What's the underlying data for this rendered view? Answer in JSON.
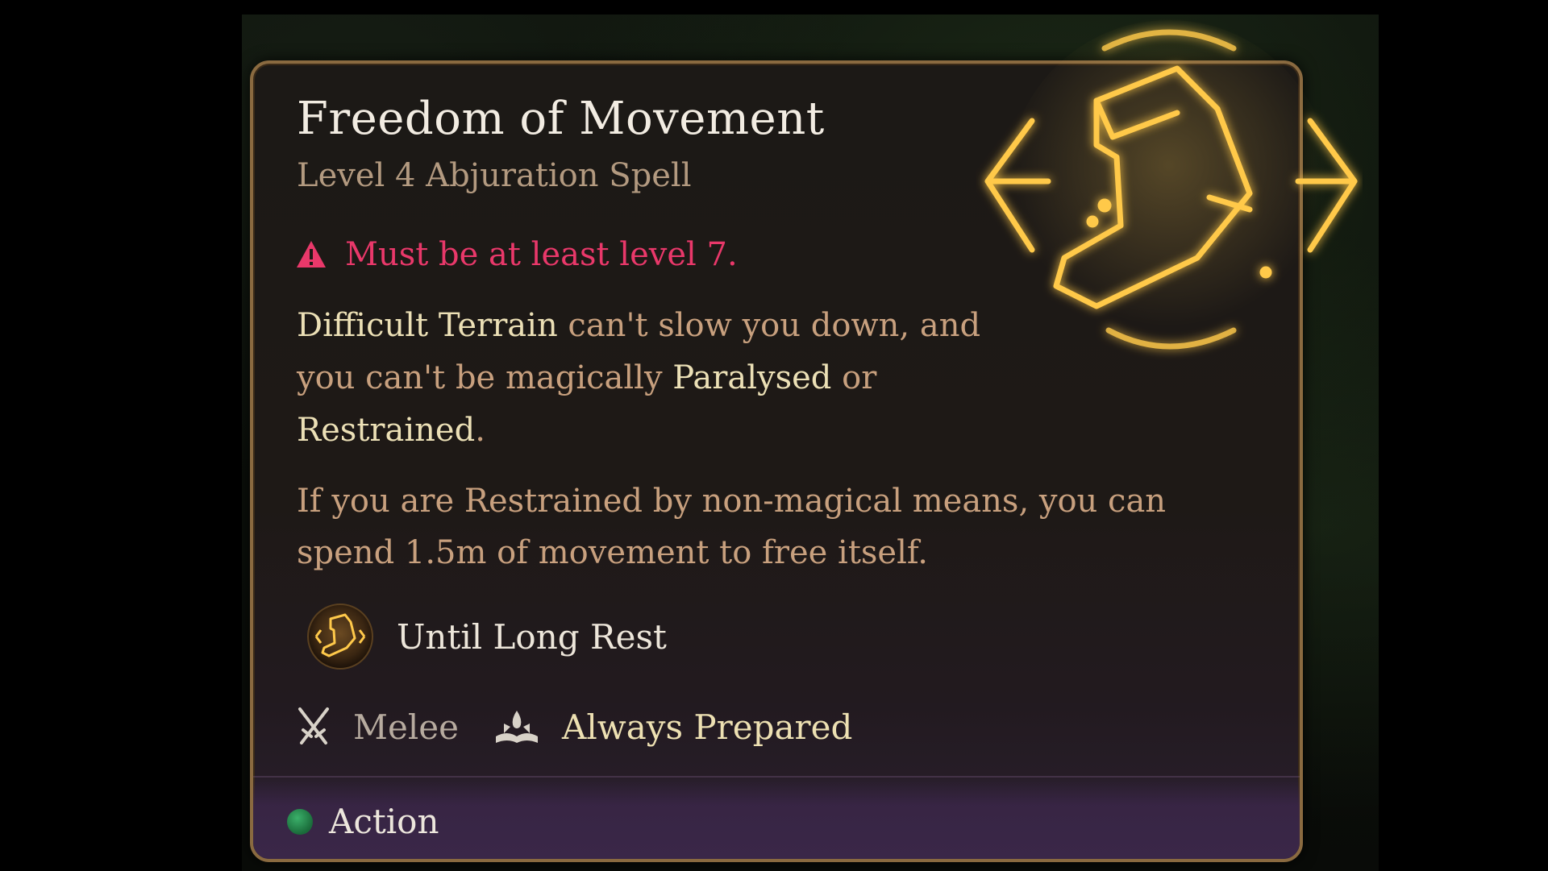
{
  "spell": {
    "name": "Freedom of Movement",
    "subtitle": "Level 4 Abjuration Spell",
    "icon": "boot-spell-icon"
  },
  "requirement": {
    "text": "Must be at least level 7.",
    "icon": "warning-triangle-icon",
    "color": "#e9386a"
  },
  "description": {
    "p1": {
      "k1": "Difficult Terrain",
      "t1": " can't slow you down, and you can't be magically ",
      "k2": "Paralysed",
      "t2": " or ",
      "k3": "Restrained",
      "t3": "."
    },
    "p2": "If you are Restrained by non-magical means, you can spend 1.5m of movement to free itself."
  },
  "duration": {
    "text": "Until Long Rest",
    "icon": "boot-medallion-icon"
  },
  "tags": [
    {
      "label": "Melee",
      "icon": "crossed-swords-icon"
    },
    {
      "label": "Always Prepared",
      "icon": "spellbook-icon"
    }
  ],
  "footer": {
    "cost_label": "Action",
    "cost_color": "#2e9a5a"
  },
  "colors": {
    "border": "#8a6a40",
    "highlight": "#ece0b6",
    "body_text": "#c8a07e",
    "glow": "#ffc94a"
  }
}
